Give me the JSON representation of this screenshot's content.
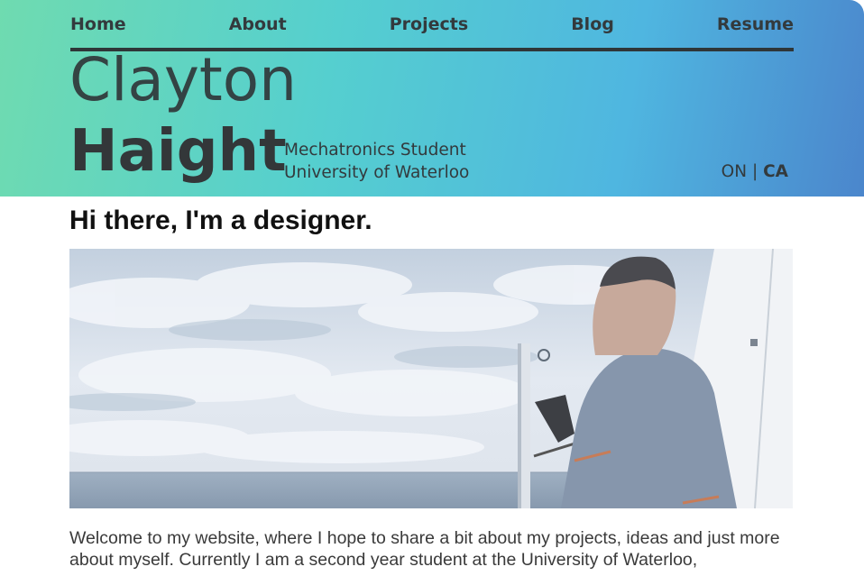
{
  "nav": {
    "items": [
      {
        "label": "Home"
      },
      {
        "label": "About"
      },
      {
        "label": "Projects"
      },
      {
        "label": "Blog"
      },
      {
        "label": "Resume"
      }
    ]
  },
  "hero_header": {
    "first_name": "Clayton",
    "last_name": "Haight",
    "subtitle_line1": "Mechatronics Student",
    "subtitle_line2": "University of Waterloo",
    "locale_region": "ON",
    "locale_separator": "|",
    "locale_country": "CA"
  },
  "main": {
    "headline": "Hi there, I'm a designer.",
    "intro_text": "Welcome to my website, where I hope to share a bit about my projects, ideas and just more about myself. Currently I am a second year student at the University of Waterloo,"
  },
  "colors": {
    "gradient_start": "#6fdbb0",
    "gradient_end": "#4b86cc",
    "text_dark": "#333a3d"
  }
}
